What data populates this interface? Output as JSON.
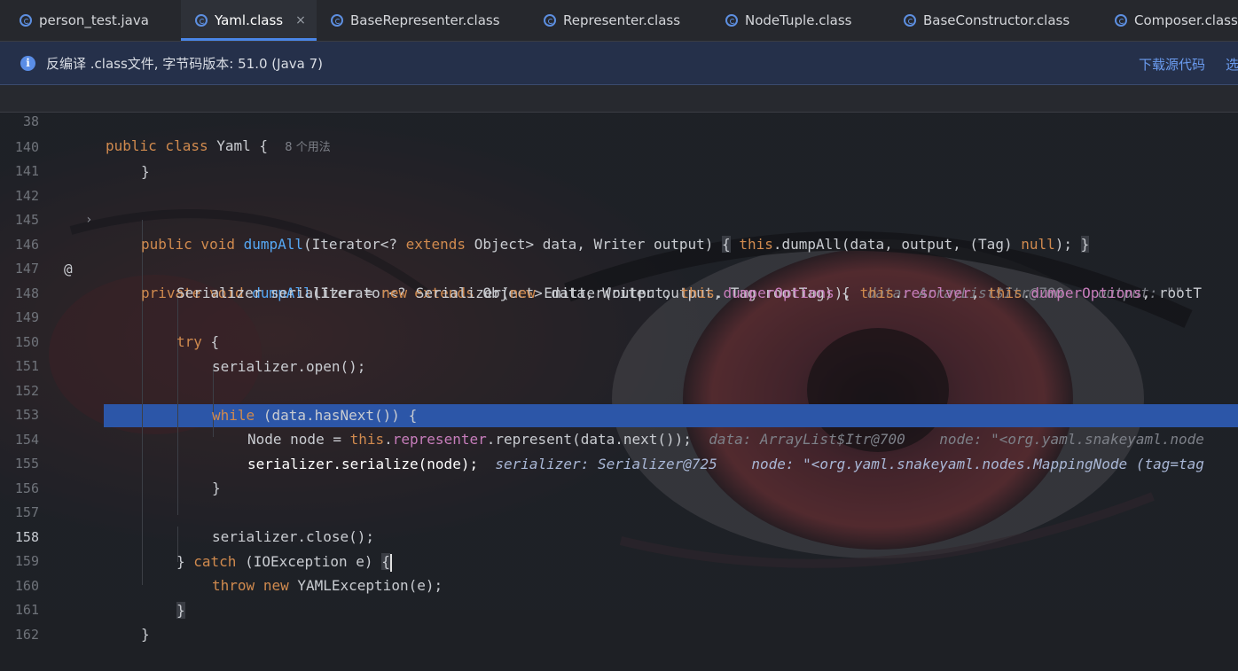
{
  "tabs": [
    {
      "label": "person_test.java",
      "active": false
    },
    {
      "label": "Yaml.class",
      "active": true
    },
    {
      "label": "BaseRepresenter.class",
      "active": false
    },
    {
      "label": "Representer.class",
      "active": false
    },
    {
      "label": "NodeTuple.class",
      "active": false
    },
    {
      "label": "BaseConstructor.class",
      "active": false
    },
    {
      "label": "Composer.class",
      "active": false
    }
  ],
  "tab_close_glyph": "×",
  "banner": {
    "info_glyph": "i",
    "text": "反编译 .class文件, 字节码版本: 51.0 (Java 7)",
    "download_link": "下载源代码",
    "select_link": "选"
  },
  "sticky": {
    "line_number": "38",
    "code_kw": "public class",
    "code_name": "Yaml {",
    "usages": "8 个用法"
  },
  "lines": {
    "l140": {
      "n": "140",
      "t": "}"
    },
    "l141": {
      "n": "141"
    },
    "l142": {
      "n": "142",
      "kw": "public void ",
      "fn": "dumpAll",
      "a": "(Iterator<? ",
      "kw2": "extends",
      "b": " Object> data, Writer output) ",
      "br1": "{",
      "sp": " ",
      "kw3": "this",
      "c": ".dumpAll(data, output, (Tag) ",
      "kw4": "null",
      "d": "); ",
      "br2": "}"
    },
    "l145": {
      "n": "145"
    },
    "l146": {
      "n": "146",
      "kw": "private void ",
      "fn": "dumpAll",
      "a": "(Iterator<? ",
      "kw2": "extends",
      "b": " Object> data, Writer output, Tag rootTag) {",
      "h1": "data: ArrayList$Itr@700",
      "h2": "output: \"\""
    },
    "l147": {
      "n": "147",
      "a": "Serializer serializer = ",
      "kw": "new",
      "b": " Serializer(",
      "kw2": "new",
      "c": " Emitter(output, ",
      "kw3": "this",
      "d": ".",
      "f1": "dumperOptions",
      "e": "), ",
      "kw4": "this",
      "g": ".",
      "f2": "resolver",
      "h": ", ",
      "kw5": "this",
      "i": ".",
      "f3": "dumperOptions",
      "j": ", rootT"
    },
    "l148": {
      "n": "148"
    },
    "l149": {
      "n": "149",
      "kw": "try",
      "a": " {"
    },
    "l150": {
      "n": "150",
      "t": "serializer.open();"
    },
    "l151": {
      "n": "151"
    },
    "l152": {
      "n": "152",
      "kw": "while",
      "a": " (data.hasNext()) {"
    },
    "l153": {
      "n": "153",
      "a": "Node node = ",
      "kw": "this",
      "b": ".",
      "f": "representer",
      "c": ".represent(data.next());",
      "h1": "data: ArrayList$Itr@700",
      "h2": "node: \"<org.yaml.snakeyaml.node"
    },
    "l154": {
      "n": "154",
      "t": "serializer.serialize(node);",
      "h1": "serializer: Serializer@725",
      "h2": "node: \"<org.yaml.snakeyaml.nodes.MappingNode (tag=tag"
    },
    "l155": {
      "n": "155",
      "t": "}"
    },
    "l156": {
      "n": "156"
    },
    "l157": {
      "n": "157",
      "t": "serializer.close();"
    },
    "l158": {
      "n": "158",
      "a": "} ",
      "kw": "catch",
      "b": " (IOException e) ",
      "br": "{"
    },
    "l159": {
      "n": "159",
      "kw": "throw",
      "sp": " ",
      "kw2": "new",
      "a": " YAMLException(e);"
    },
    "l160": {
      "n": "160",
      "br": "}"
    },
    "l161": {
      "n": "161",
      "t": "}"
    },
    "l162": {
      "n": "162"
    }
  },
  "gutter_icons": {
    "override": "@",
    "fold": "›"
  },
  "colors": {
    "keyword": "#d08a4e",
    "function": "#56a8f5",
    "field": "#c77dbb",
    "execution_line": "#2c56a8",
    "link": "#6b9cf0"
  }
}
